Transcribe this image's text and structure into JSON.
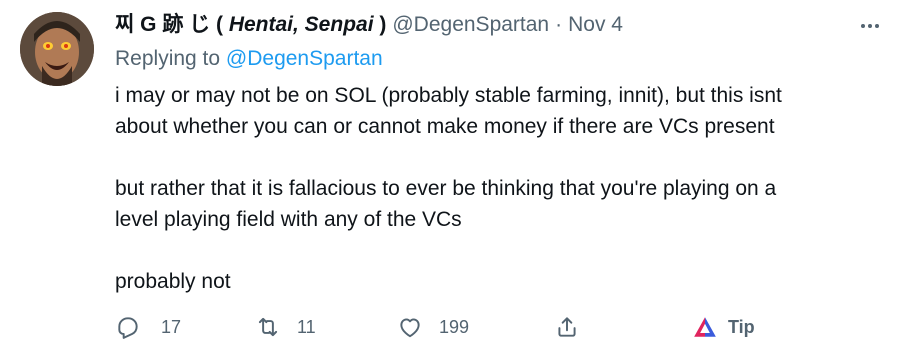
{
  "tweet": {
    "display_name_prefix": "찌 G 跡 じ ( ",
    "display_name_italic": "Hentai, Senpai",
    "display_name_suffix": " )",
    "handle": "@DegenSpartan",
    "separator": "·",
    "date": "Nov 4",
    "replying_prefix": "Replying to ",
    "replying_to": "@DegenSpartan",
    "body_lines": [
      "i may or may not be on SOL (probably stable farming, innit), but this isnt",
      "about whether you can or cannot make money if there are VCs present",
      "but rather that it is fallacious to ever be thinking that you're playing on a",
      "level playing field with any of the VCs",
      "probably not"
    ]
  },
  "actions": {
    "reply_count": "17",
    "retweet_count": "11",
    "like_count": "199",
    "tip_label": "Tip"
  },
  "icons": {
    "more": "more-horizontal-icon",
    "reply": "reply-icon",
    "retweet": "retweet-icon",
    "like": "heart-icon",
    "share": "share-icon",
    "tip": "tip-triangle-icon"
  },
  "colors": {
    "text": "#0f1419",
    "secondary": "#536471",
    "accent": "#1d9bf0",
    "tip_left": "#e0245e",
    "tip_right": "#3b5bdb"
  }
}
